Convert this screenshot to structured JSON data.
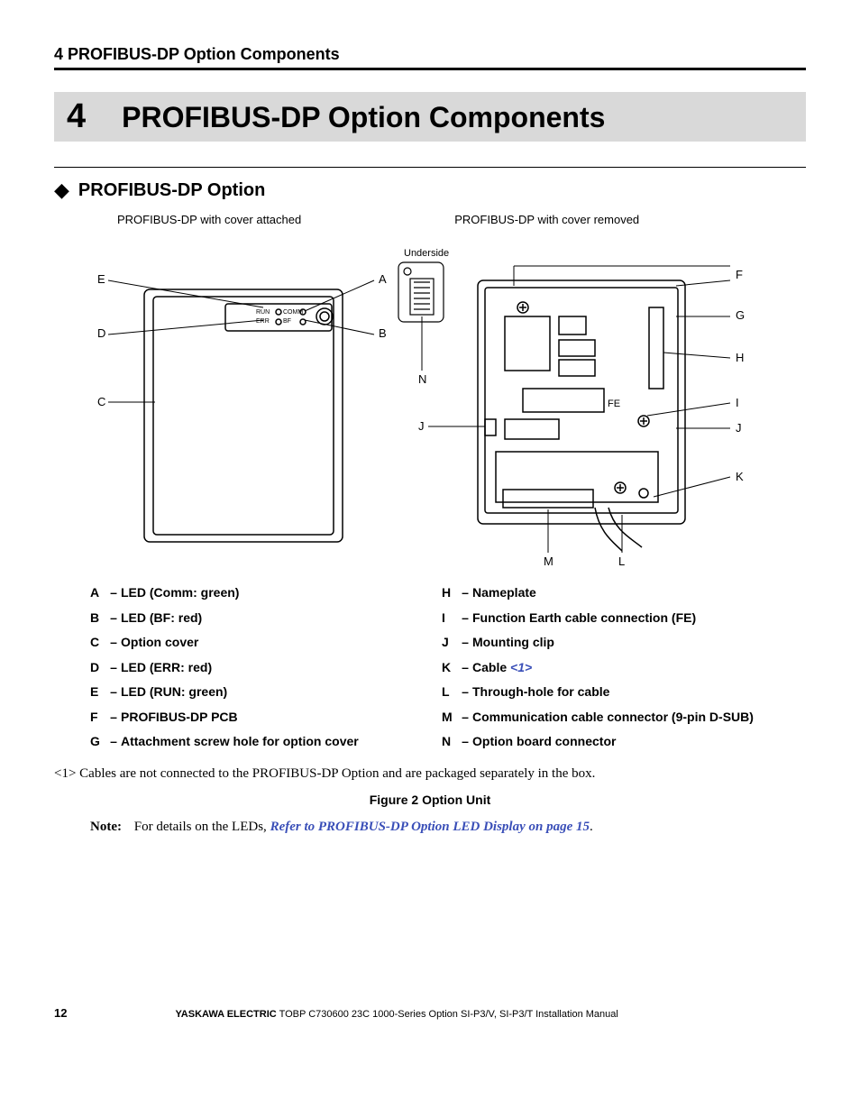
{
  "running_header": "4  PROFIBUS-DP Option Components",
  "chapter": {
    "number": "4",
    "title": "PROFIBUS-DP Option Components"
  },
  "subsection_title": "PROFIBUS-DP Option",
  "diagram": {
    "caption_left": "PROFIBUS-DP with cover attached",
    "caption_right": "PROFIBUS-DP with cover removed",
    "underside_label": "Underside",
    "left_labels": [
      "E",
      "A",
      "D",
      "B",
      "C",
      "N",
      "J"
    ],
    "right_labels": [
      "F",
      "G",
      "H",
      "I",
      "J",
      "K"
    ],
    "bottom_labels": [
      "M",
      "L"
    ],
    "pcb_text": {
      "run": "RUN",
      "err": "ERR",
      "comm": "COMM",
      "bf": "BF",
      "fe": "FE"
    }
  },
  "legend": {
    "left": [
      {
        "l": "A",
        "t": "LED (Comm: green)"
      },
      {
        "l": "B",
        "t": "LED (BF: red)"
      },
      {
        "l": "C",
        "t": "Option cover"
      },
      {
        "l": "D",
        "t": "LED (ERR: red)"
      },
      {
        "l": "E",
        "t": "LED (RUN: green)"
      },
      {
        "l": "F",
        "t": "PROFIBUS-DP PCB"
      },
      {
        "l": "G",
        "t": "Attachment screw hole for option cover"
      }
    ],
    "right": [
      {
        "l": "H",
        "t": "Nameplate"
      },
      {
        "l": "I",
        "t": "Function Earth cable connection (FE)"
      },
      {
        "l": "J",
        "t": "Mounting clip"
      },
      {
        "l": "K",
        "t": "Cable",
        "ref": "<1>"
      },
      {
        "l": "L",
        "t": "Through-hole for cable"
      },
      {
        "l": "M",
        "t": "Communication cable connector (9-pin D-SUB)"
      },
      {
        "l": "N",
        "t": "Option board connector"
      }
    ]
  },
  "footnote": "<1> Cables are not connected to the PROFIBUS-DP Option and are packaged separately in the box.",
  "figure_caption": "Figure 2  Option Unit",
  "note": {
    "label": "Note:",
    "text_before": "For details on the LEDs, ",
    "link": "Refer to PROFIBUS-DP Option LED Display on page 15",
    "after": "."
  },
  "footer": {
    "page": "12",
    "company": "YASKAWA ELECTRIC",
    "doc": " TOBP C730600 23C 1000-Series Option SI-P3/V, SI-P3/T Installation Manual"
  }
}
